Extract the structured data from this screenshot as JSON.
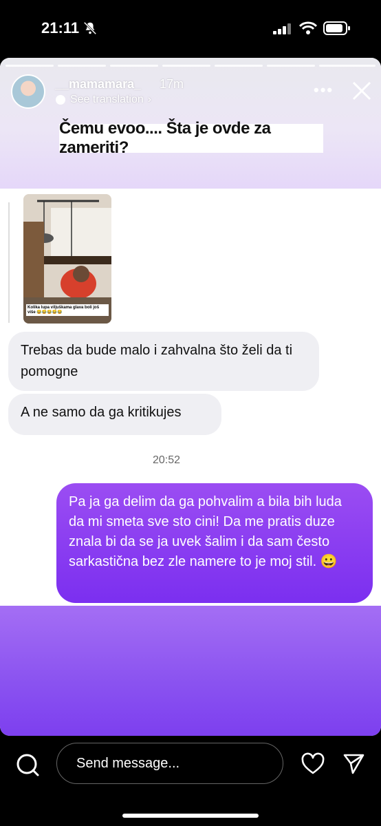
{
  "status_bar": {
    "time": "21:11",
    "icons": [
      "bell-off-icon",
      "signal-icon",
      "wifi-icon",
      "battery-icon"
    ]
  },
  "story": {
    "username": "__mamamara_",
    "time_ago": "17m",
    "see_translation": "See translation",
    "caption": "Čemu evoo.... Šta je ovde za zameriti?",
    "progress_segments": 7,
    "accent": "#8a52f0"
  },
  "chat": {
    "thumbnail_caption": "Kolika lupa viljuškama glava boli još više 😂😂😂😂😂",
    "incoming": [
      "Trebas da bude malo i zahvalna što želi da ti pomogne",
      "A ne samo da ga kritikujes"
    ],
    "timestamp": "20:52",
    "outgoing": "Pa ja ga delim da ga pohvalim a bila bih luda da mi smeta sve sto cini! Da me pratis duze znala bi da se ja uvek šalim i da sam često sarkastična bez zle namere  to je moj stil. 😀"
  },
  "bottom_bar": {
    "placeholder": "Send message...",
    "icons": [
      "camera-icon",
      "heart-icon",
      "send-icon"
    ]
  }
}
